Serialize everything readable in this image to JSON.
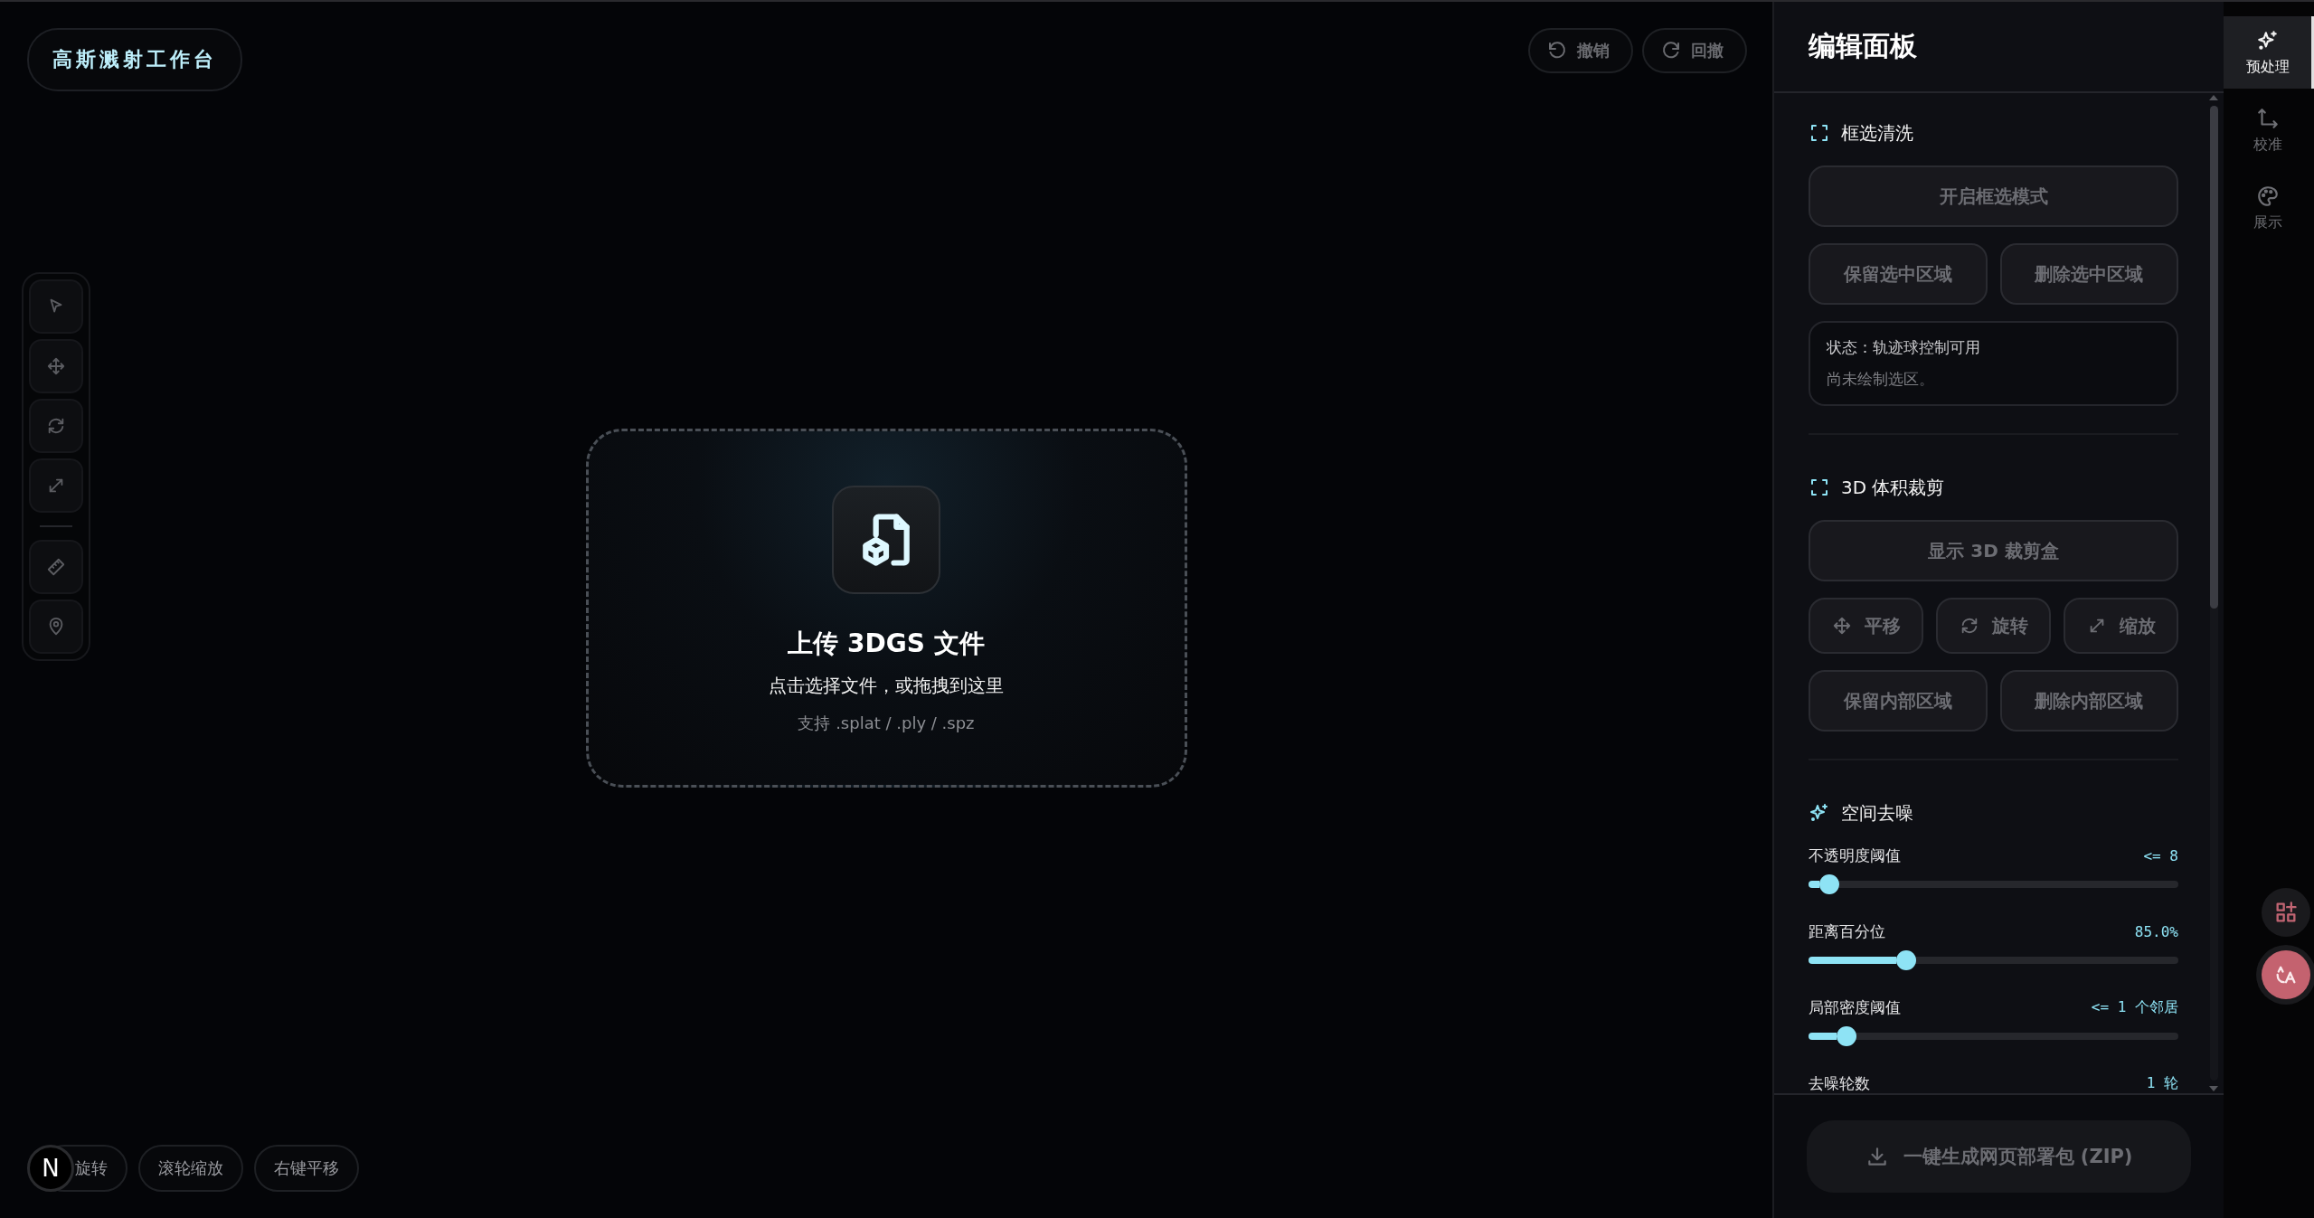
{
  "title": "高斯溅射工作台",
  "history_buttons": [
    {
      "label": "撤销"
    },
    {
      "label": "回撤"
    }
  ],
  "upload": {
    "title": "上传 3DGS 文件",
    "subtitle": "点击选择文件，或拖拽到这里",
    "formats": "支持 .splat / .ply / .spz"
  },
  "badge": "N",
  "hints": [
    "旋转",
    "滚轮缩放",
    "右键平移"
  ],
  "panel": {
    "title": "编辑面板",
    "sections": [
      {
        "heading": "框选清洗",
        "items": [
          {
            "kind": "button",
            "label": "开启框选模式",
            "disabled": true
          },
          {
            "kind": "button_row",
            "buttons": [
              {
                "label": "保留选中区域",
                "disabled": true
              },
              {
                "label": "删除选中区域",
                "disabled": true
              }
            ]
          },
          {
            "kind": "status",
            "lines": [
              "状态：轨迹球控制可用",
              "尚未绘制选区。"
            ]
          }
        ]
      },
      {
        "heading": "3D 体积裁剪",
        "items": [
          {
            "kind": "button",
            "label": "显示 3D 裁剪盒",
            "disabled": true
          },
          {
            "kind": "icon_button_row",
            "buttons": [
              {
                "label": "平移",
                "disabled": true
              },
              {
                "label": "旋转",
                "disabled": true
              },
              {
                "label": "缩放",
                "disabled": true
              }
            ]
          },
          {
            "kind": "button_row",
            "buttons": [
              {
                "label": "保留内部区域",
                "disabled": true
              },
              {
                "label": "删除内部区域",
                "disabled": true
              }
            ]
          }
        ]
      },
      {
        "heading": "空间去噪",
        "items": [
          {
            "kind": "slider",
            "label": "不透明度阈值",
            "reading": "<= 8",
            "level": 0.03
          },
          {
            "kind": "slider",
            "label": "距离百分位",
            "reading": "85.0%",
            "level": 0.25
          },
          {
            "kind": "slider",
            "label": "局部密度阈值",
            "reading": "<= 1 个邻居",
            "level": 0.08
          },
          {
            "kind": "slider",
            "label": "去噪轮数",
            "reading": "1 轮"
          }
        ]
      }
    ],
    "export_button": {
      "label": "一键生成网页部署包 (ZIP)",
      "disabled": true
    }
  },
  "rail": [
    {
      "label": "预处理",
      "selected": true
    },
    {
      "label": "校准",
      "selected": false
    },
    {
      "label": "展示",
      "selected": false
    }
  ]
}
